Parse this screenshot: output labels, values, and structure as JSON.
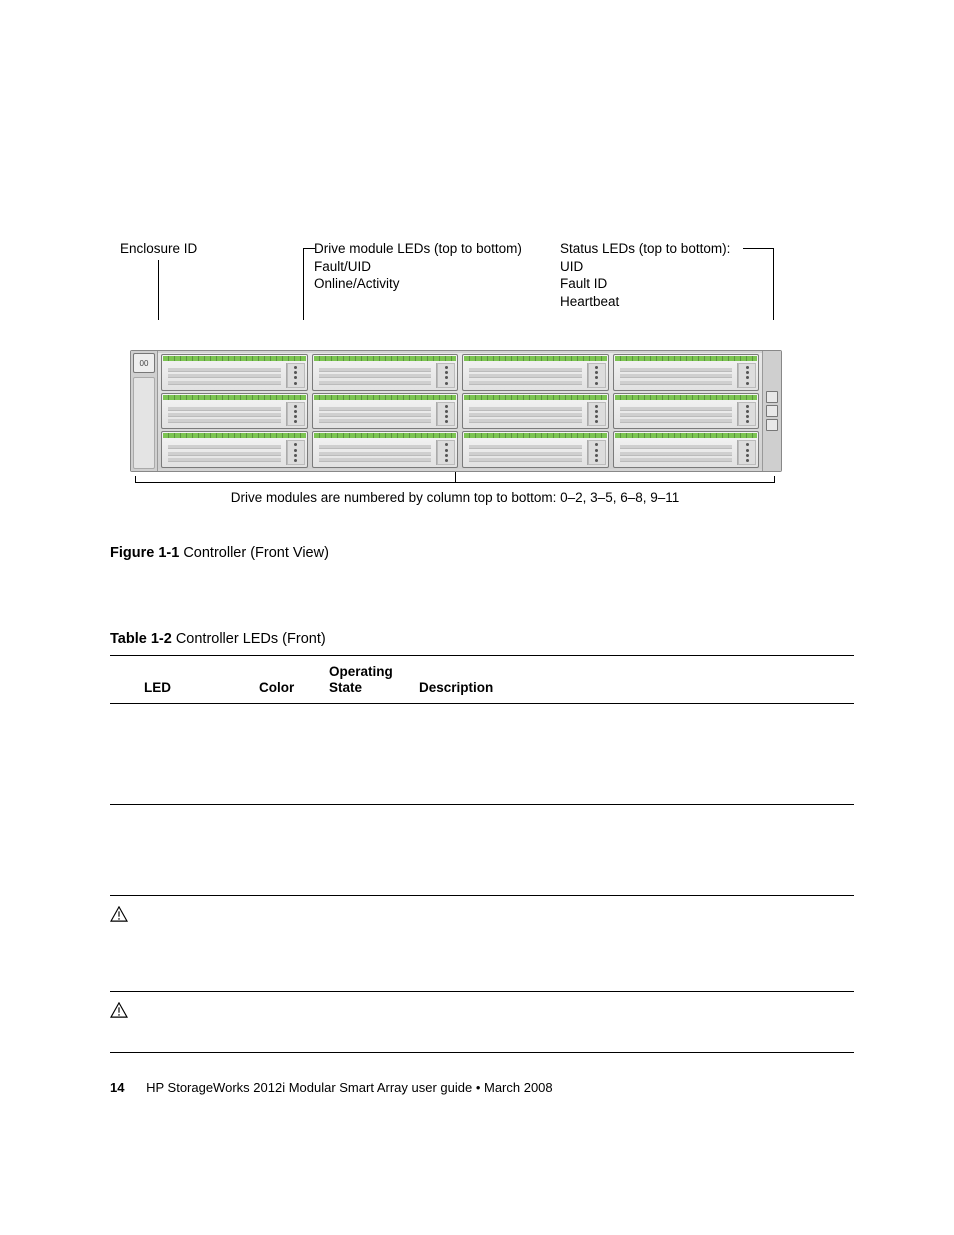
{
  "callouts": {
    "enclosure_id": "Enclosure ID",
    "drive_leds_title": "Drive module LEDs (top to bottom)",
    "drive_leds_l1": "Fault/UID",
    "drive_leds_l2": "Online/Activity",
    "status_leds_title": "Status LEDs (top to bottom):",
    "status_leds_l1": "UID",
    "status_leds_l2": "Fault ID",
    "status_leds_l3": "Heartbeat"
  },
  "below_caption": "Drive modules are numbered by column top to bottom: 0–2, 3–5, 6–8, 9–11",
  "figure": {
    "label": "Figure 1-1",
    "title": "Controller (Front View)"
  },
  "table": {
    "label": "Table 1-2",
    "title": "Controller LEDs (Front)",
    "headers": {
      "led": "LED",
      "color": "Color",
      "op1": "Operating",
      "op2": "State",
      "desc": "Description"
    }
  },
  "footer": {
    "page_no": "14",
    "text": "HP StorageWorks 2012i Modular Smart Array user guide  •  March 2008"
  }
}
